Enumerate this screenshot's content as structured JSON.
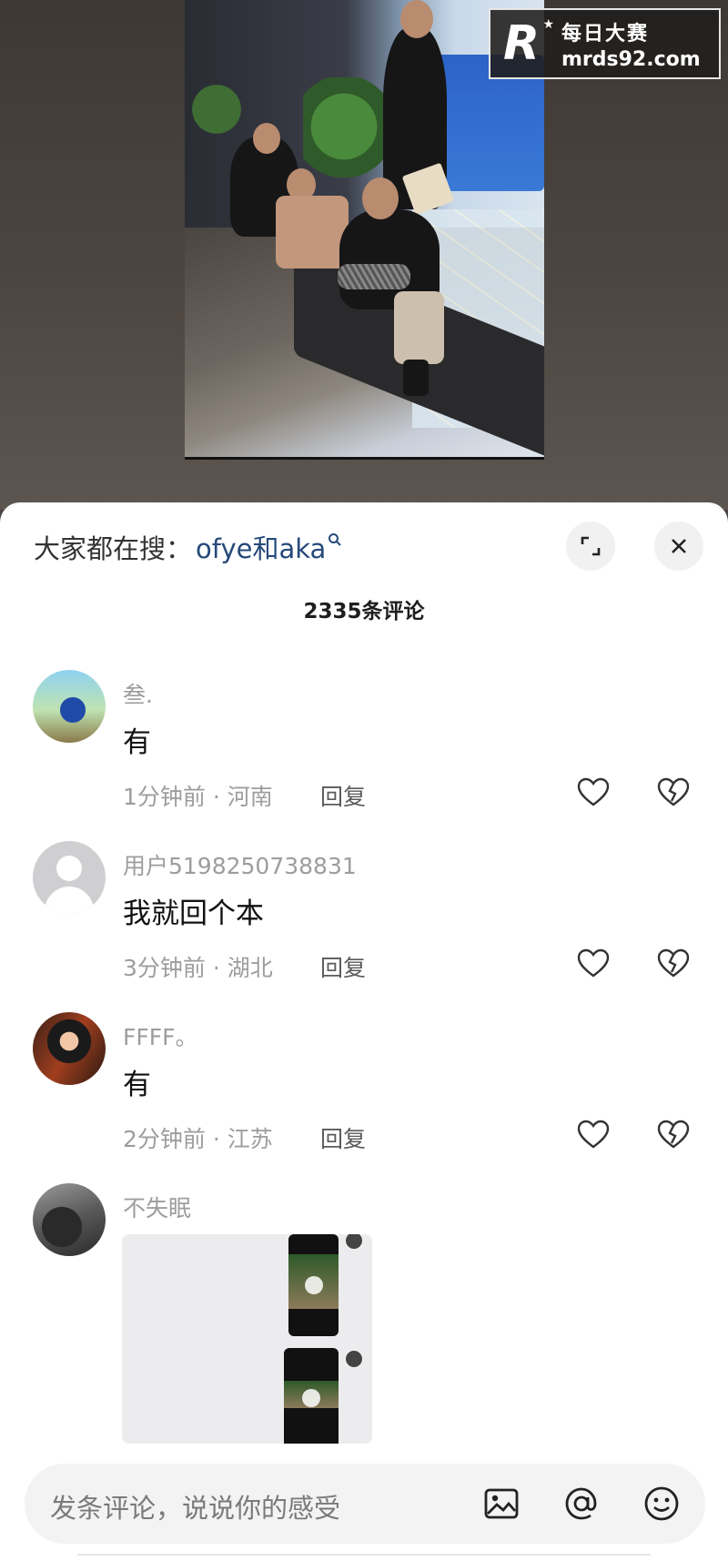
{
  "watermark": {
    "brand_cn": "每日大赛",
    "url": "mrds92.com"
  },
  "sheet": {
    "hot_search_label": "大家都在搜：",
    "hot_search_keyword": "ofye和aka",
    "comment_count": "2335条评论"
  },
  "comments": [
    {
      "user": "叁.",
      "text": "有",
      "time_location": "1分钟前 · 河南",
      "reply": "回复"
    },
    {
      "user": "用户5198250738831",
      "text": "我就回个本",
      "time_location": "3分钟前 · 湖北",
      "reply": "回复"
    },
    {
      "user": "FFFF。",
      "text": "有",
      "time_location": "2分钟前 · 江苏",
      "reply": "回复"
    },
    {
      "user": "不失眠",
      "text": "",
      "time_location": "",
      "reply": ""
    }
  ],
  "input": {
    "placeholder": "发条评论，说说你的感受"
  },
  "icons": {
    "expand": "expand-icon",
    "close": "close-icon",
    "like": "heart-icon",
    "dislike": "broken-heart-icon",
    "image": "image-icon",
    "mention": "at-icon",
    "emoji": "emoji-icon"
  },
  "colors": {
    "keyword": "#25497a",
    "meta": "#9d9d9d",
    "sheet_bg": "#ffffff",
    "input_bg": "#f3f3f3"
  }
}
